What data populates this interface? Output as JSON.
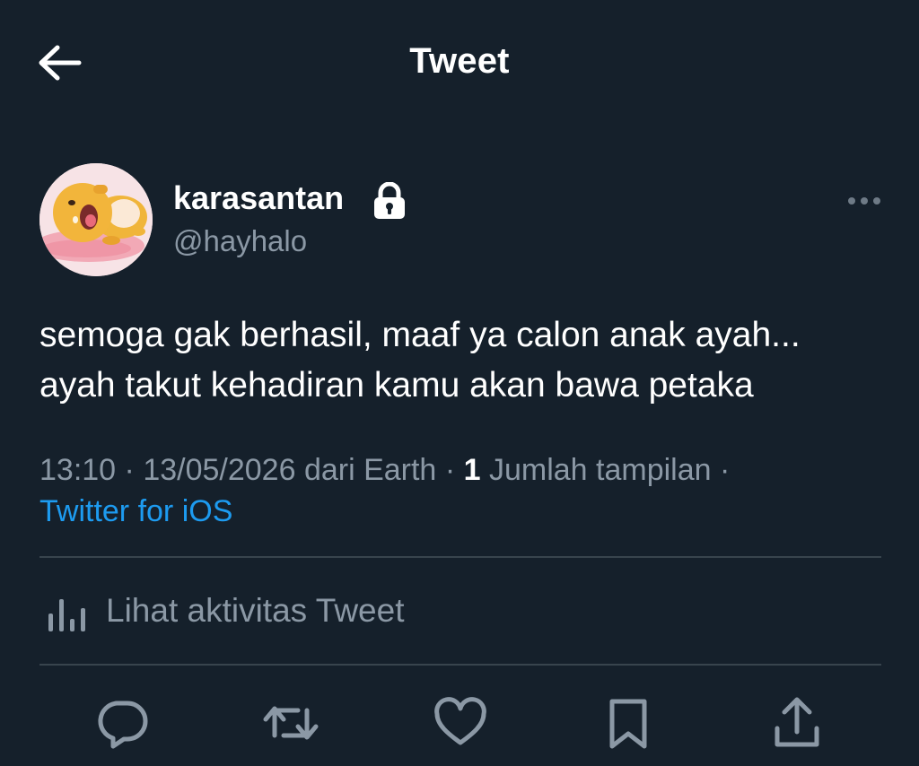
{
  "header": {
    "title": "Tweet",
    "back_icon": "arrow-left-icon"
  },
  "author": {
    "display_name": "karasantan",
    "handle": "@hayhalo",
    "protected_icon": "lock-icon",
    "avatar": "yellow-cartoon-character-lying-down"
  },
  "more_icon": "more-horizontal-icon",
  "tweet": {
    "lines": [
      "semoga gak berhasil, maaf ya calon anak ayah...",
      "ayah takut kehadiran kamu akan bawa petaka"
    ]
  },
  "meta": {
    "time": "13:10",
    "separator": "·",
    "date": "13/05/2026 dari Earth",
    "views_count": "1",
    "views_label": "Jumlah tampilan",
    "source": "Twitter for iOS"
  },
  "activity": {
    "label": "Lihat aktivitas Tweet",
    "icon": "bar-chart-icon"
  },
  "actions": [
    {
      "name": "reply",
      "icon": "reply-icon"
    },
    {
      "name": "retweet",
      "icon": "retweet-icon"
    },
    {
      "name": "like",
      "icon": "heart-icon"
    },
    {
      "name": "bookmark",
      "icon": "bookmark-icon"
    },
    {
      "name": "share",
      "icon": "share-icon"
    }
  ],
  "colors": {
    "background": "#15202b",
    "text_primary": "#ffffff",
    "text_secondary": "#8b98a5",
    "link": "#1d9bf0",
    "divider": "#38444d"
  }
}
